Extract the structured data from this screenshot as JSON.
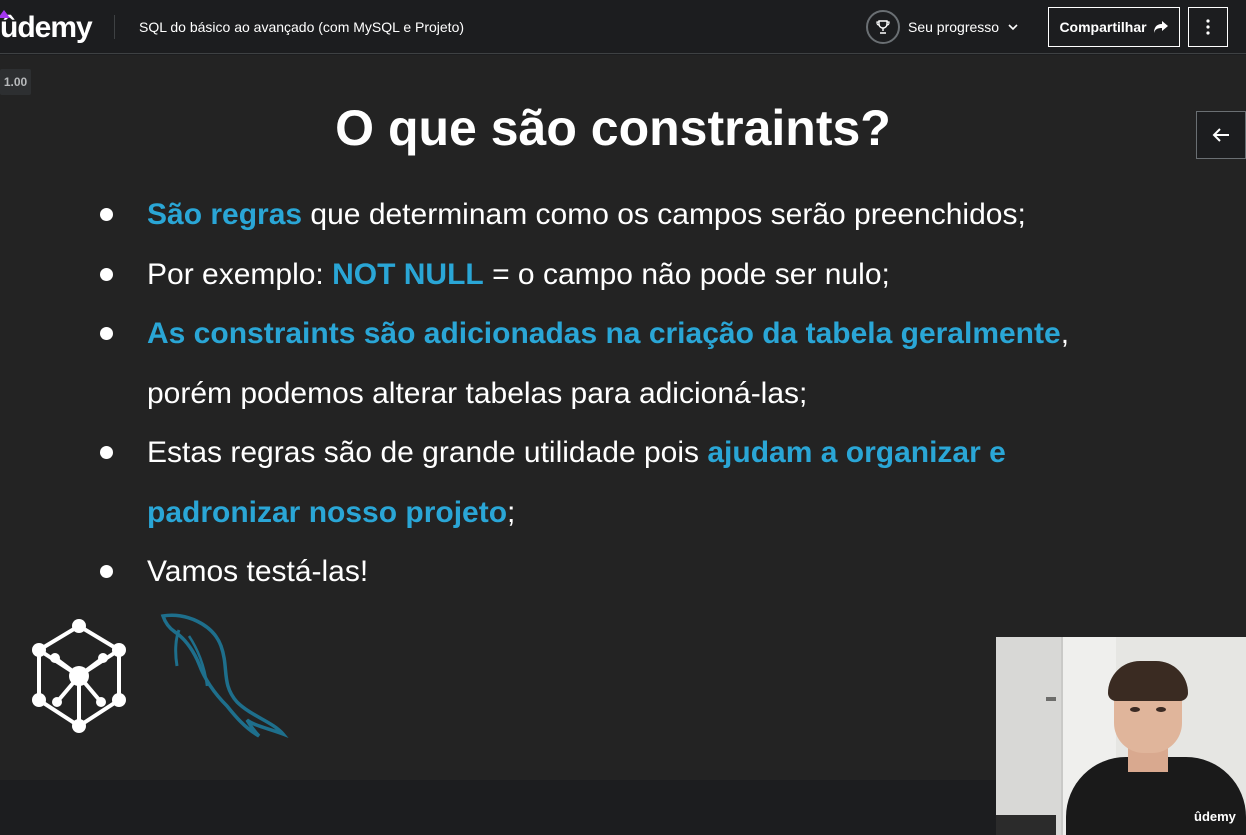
{
  "header": {
    "logo_text": "ûdemy",
    "course_title": "SQL do básico ao avançado (com MySQL e Projeto)",
    "progress_label": "Seu progresso",
    "share_label": "Compartilhar"
  },
  "player": {
    "speed": "1.00",
    "watermark": "ûdemy"
  },
  "slide": {
    "title": "O que são constraints?",
    "bullets": [
      {
        "parts": [
          {
            "text": "São regras",
            "hl": true
          },
          {
            "text": " que determinam como os campos serão preenchidos;",
            "hl": false
          }
        ]
      },
      {
        "parts": [
          {
            "text": "Por exemplo: ",
            "hl": false
          },
          {
            "text": "NOT NULL",
            "hl": true
          },
          {
            "text": " = o campo não pode ser nulo;",
            "hl": false
          }
        ]
      },
      {
        "parts": [
          {
            "text": "As constraints são adicionadas na criação da tabela geralmente",
            "hl": true
          },
          {
            "text": ", porém podemos alterar tabelas para adicioná-las;",
            "hl": false
          }
        ]
      },
      {
        "parts": [
          {
            "text": "Estas regras são de grande utilidade pois ",
            "hl": false
          },
          {
            "text": "ajudam a organizar e padronizar nosso projeto",
            "hl": true
          },
          {
            "text": ";",
            "hl": false
          }
        ]
      },
      {
        "parts": [
          {
            "text": "Vamos testá-las!",
            "hl": false
          }
        ]
      }
    ]
  },
  "colors": {
    "accent": "#2aa6d6",
    "background": "#1c1d1f",
    "slide_bg": "#232323",
    "logo_hat": "#a435f0"
  },
  "icons": {
    "progress": "trophy-icon",
    "progress_dropdown": "chevron-down-icon",
    "share": "share-arrow-icon",
    "more": "vertical-dots-icon",
    "back": "arrow-left-icon",
    "graph_logo": "graph-cube-icon",
    "mysql": "mysql-dolphin-icon"
  }
}
